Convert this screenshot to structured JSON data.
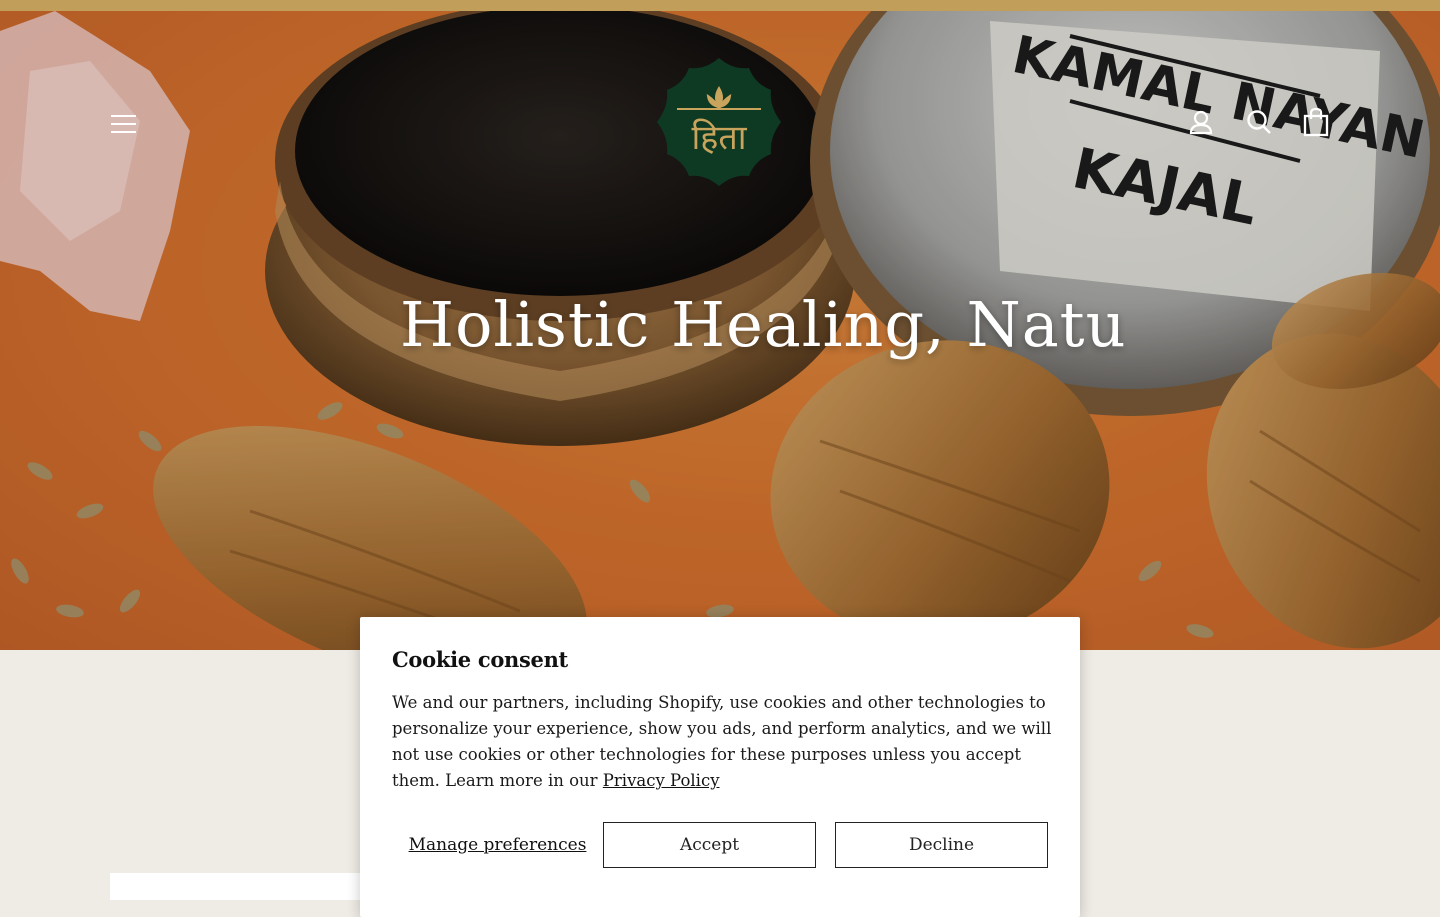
{
  "announcement_bar": {
    "color": "#c19e5a"
  },
  "header": {
    "logo_text": "हिता",
    "icons": {
      "menu": "hamburger-menu-icon",
      "account": "user-icon",
      "search": "search-icon",
      "cart": "shopping-bag-icon"
    }
  },
  "hero": {
    "title": "Holistic Healing, Natu",
    "jar_label_line1": "KAMAL NAYAN",
    "jar_label_line2": "KAJAL"
  },
  "cookie": {
    "title": "Cookie consent",
    "body": "We and our partners, including Shopify, use cookies and other technologies to personalize your experience, show you ads, and perform analytics, and we will not use cookies or other technologies for these purposes unless you accept them. Learn more in our ",
    "privacy_link": "Privacy Policy",
    "manage_label": "Manage preferences",
    "accept_label": "Accept",
    "decline_label": "Decline"
  },
  "colors": {
    "page_background": "#efebe5",
    "logo_green": "#0e3a24",
    "logo_gold": "#c9a45c",
    "hero_orange": "#d9752f"
  }
}
